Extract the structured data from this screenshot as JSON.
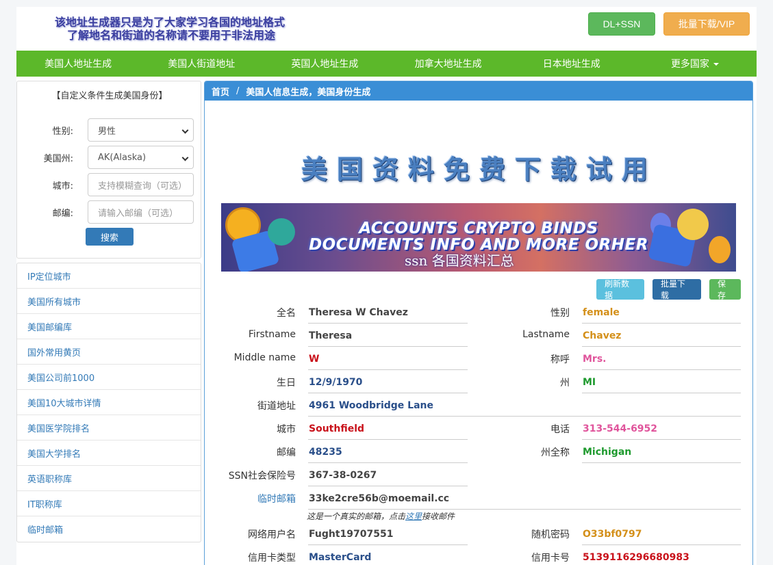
{
  "header": {
    "notice_line1": "该地址生成器只是为了大家学习各国的地址格式",
    "notice_line2": "了解地名和街道的名称请不要用于非法用途",
    "btn_ssn": "DL+SSN",
    "btn_vip": "批量下载/VIP"
  },
  "nav": {
    "items": [
      "美国人地址生成",
      "美国人街道地址",
      "英国人地址生成",
      "加拿大地址生成",
      "日本地址生成",
      "更多国家"
    ]
  },
  "sidebar": {
    "title": "【自定义条件生成美国身份】",
    "gender_label": "性别:",
    "gender_value": "男性",
    "state_label": "美国州:",
    "state_value": "AK(Alaska)",
    "city_label": "城市:",
    "city_placeholder": "支持模糊查询（可选）",
    "zip_label": "邮编:",
    "zip_placeholder": "请输入邮编（可选）",
    "search_button": "搜索",
    "links": [
      "IP定位城市",
      "美国所有城市",
      "美国邮编库",
      "国外常用黄页",
      "美国公司前1000",
      "美国10大城市详情",
      "美国医学院排名",
      "美国大学排名",
      "英语职称库",
      "IT职称库",
      "临时邮箱"
    ]
  },
  "main": {
    "breadcrumb_home": "首页",
    "breadcrumb_sep": "/",
    "breadcrumb_current": "美国人信息生成，美国身份生成",
    "big_title": "美国资料免费下载试用",
    "banner_line1": "ACCOUNTS CRYPTO BINDS",
    "banner_line2": "DOCUMENTS INFO AND MORE ORHER",
    "banner_line3": "ssn 各国资料汇总",
    "btn_refresh": "刷新数据",
    "btn_batch": "批量下载",
    "btn_save": "保存"
  },
  "info": {
    "fullname_label": "全名",
    "fullname": "Theresa W Chavez",
    "gender_label": "性别",
    "gender": "female",
    "firstname_label": "Firstname",
    "firstname": "Theresa",
    "lastname_label": "Lastname",
    "lastname": "Chavez",
    "middlename_label": "Middle name",
    "middlename": "W",
    "title_label": "称呼",
    "title": "Mrs.",
    "birthday_label": "生日",
    "birthday": "12/9/1970",
    "state_label": "州",
    "state": "MI",
    "street_label": "街道地址",
    "street": "4961 Woodbridge Lane",
    "city_label": "城市",
    "city": "Southfield",
    "phone_label": "电话",
    "phone": "313-544-6952",
    "zip_label": "邮编",
    "zip": "48235",
    "statefull_label": "州全称",
    "statefull": "Michigan",
    "ssn_label": "SSN社会保险号",
    "ssn": "367-38-0267",
    "email_label": "临时邮箱",
    "email": "33ke2cre56b@moemail.cc",
    "email_note_pre": "这是一个真实的邮箱，点击",
    "email_note_link": "这里",
    "email_note_post": "接收邮件",
    "username_label": "网络用户名",
    "username": "Fught19707551",
    "password_label": "随机密码",
    "password": "O33bf0797",
    "cardtype_label": "信用卡类型",
    "cardtype": "MasterCard",
    "cardnum_label": "信用卡号",
    "cardnum": "5139116296680983"
  }
}
